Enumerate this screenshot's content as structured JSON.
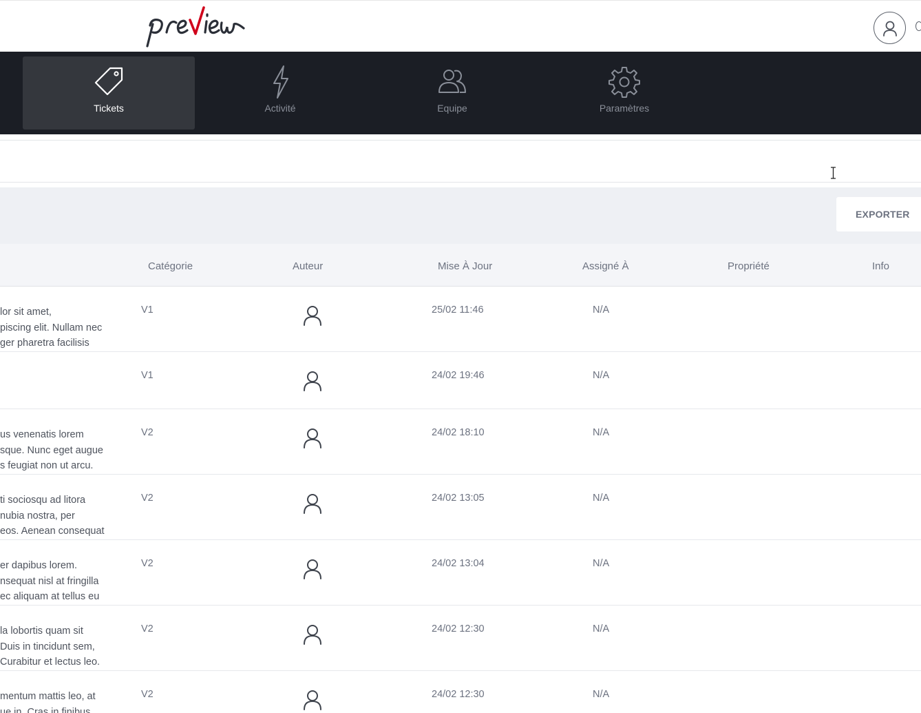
{
  "brand": {
    "logo_text": "preview"
  },
  "nav": {
    "items": [
      {
        "label": "Tickets",
        "icon": "tag-icon",
        "active": true
      },
      {
        "label": "Activité",
        "icon": "lightning-icon",
        "active": false
      },
      {
        "label": "Equipe",
        "icon": "team-icon",
        "active": false
      },
      {
        "label": "Paramètres",
        "icon": "gear-icon",
        "active": false
      }
    ]
  },
  "toolbar": {
    "export_label": "EXPORTER"
  },
  "table": {
    "headers": {
      "categorie": "Catégorie",
      "auteur": "Auteur",
      "mise_a_jour": "Mise À Jour",
      "assigne": "Assigné À",
      "propriete": "Propriété",
      "info": "Info"
    },
    "rows": [
      {
        "desc": [
          "lor sit amet,",
          "piscing elit. Nullam nec",
          "ger pharetra facilisis"
        ],
        "categorie": "V1",
        "date": "25/02 11:46",
        "assigne": "N/A"
      },
      {
        "desc": [],
        "categorie": "V1",
        "date": "24/02 19:46",
        "assigne": "N/A"
      },
      {
        "desc": [
          "us venenatis lorem",
          "sque. Nunc eget augue",
          "s feugiat non ut arcu."
        ],
        "categorie": "V2",
        "date": "24/02 18:10",
        "assigne": "N/A"
      },
      {
        "desc": [
          "ti sociosqu ad litora",
          "nubia nostra, per",
          "eos. Aenean consequat"
        ],
        "categorie": "V2",
        "date": "24/02 13:05",
        "assigne": "N/A"
      },
      {
        "desc": [
          "er dapibus lorem.",
          "nsequat nisl at fringilla",
          "ec aliquam at tellus eu"
        ],
        "categorie": "V2",
        "date": "24/02 13:04",
        "assigne": "N/A"
      },
      {
        "desc": [
          "la lobortis quam sit",
          "Duis in tincidunt sem,",
          "Curabitur et lectus leo."
        ],
        "categorie": "V2",
        "date": "24/02 12:30",
        "assigne": "N/A"
      },
      {
        "desc": [
          "mentum mattis leo, at",
          "ue in. Cras in finibus"
        ],
        "categorie": "V2",
        "date": "24/02 12:30",
        "assigne": "N/A"
      }
    ]
  },
  "colors": {
    "navbar_bg": "#1b1e25",
    "nav_active_bg": "#34373d",
    "logo_accent": "#d0021b",
    "toolbar_bg": "#eef0f4"
  }
}
